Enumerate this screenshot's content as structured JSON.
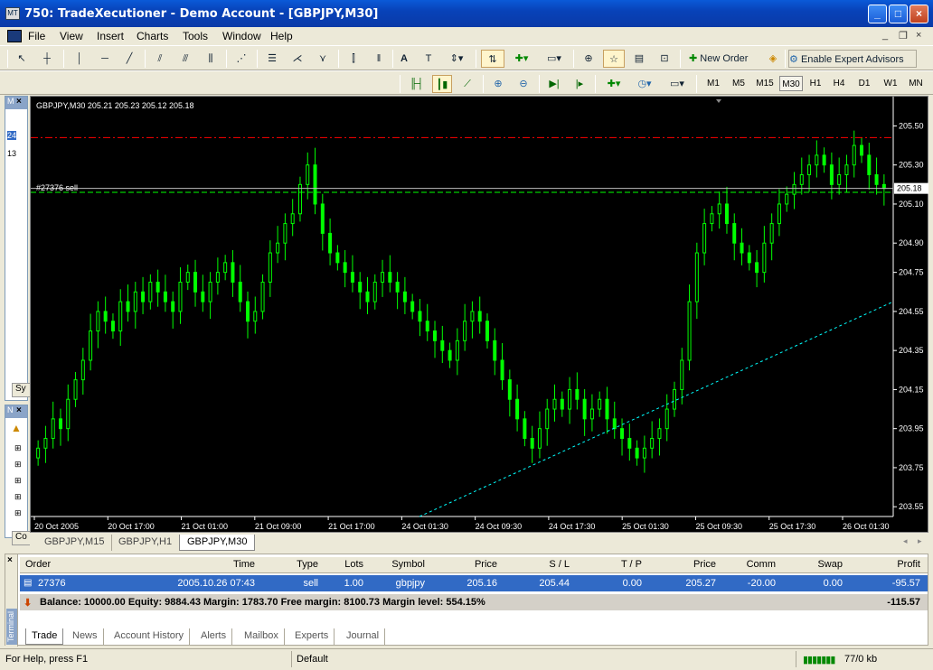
{
  "window": {
    "title": "750: TradeXecutioner - Demo Account - [GBPJPY,M30]",
    "app_icon": "mt-icon",
    "controls": [
      "minimize",
      "maximize",
      "close"
    ]
  },
  "menu": {
    "items": [
      "File",
      "View",
      "Insert",
      "Charts",
      "Tools",
      "Window",
      "Help"
    ],
    "mdi_controls": [
      "_",
      "❐",
      "×"
    ]
  },
  "toolbar": {
    "text_tool": "A",
    "new_order_label": "New Order",
    "expert_label": "Enable Expert Advisors"
  },
  "timeframes": [
    "M1",
    "M5",
    "M15",
    "M30",
    "H1",
    "H4",
    "D1",
    "W1",
    "MN"
  ],
  "active_timeframe": "M30",
  "chart": {
    "header": "GBPJPY,M30  205.21 205.23 205.12 205.18",
    "order_label": "#27376 sell",
    "current_price": "205.18",
    "price_ticks": [
      "205.50",
      "205.30",
      "205.10",
      "204.90",
      "204.75",
      "204.55",
      "204.35",
      "204.15",
      "203.95",
      "203.75",
      "203.55"
    ],
    "time_ticks": [
      "20 Oct 2005",
      "20 Oct 17:00",
      "21 Oct 01:00",
      "21 Oct 09:00",
      "21 Oct 17:00",
      "24 Oct 01:30",
      "24 Oct 09:30",
      "24 Oct 17:30",
      "25 Oct 01:30",
      "25 Oct 09:30",
      "25 Oct 17:30",
      "26 Oct 01:30"
    ],
    "colors": {
      "background": "#000000",
      "candles": "#00ff00",
      "stop_loss": "#ff0000",
      "trend_line": "#00ffff",
      "grid_text": "#ffffff"
    }
  },
  "chart_data": {
    "type": "candlestick",
    "title": "GBPJPY,M30",
    "ylim": [
      203.5,
      205.65
    ],
    "closes": [
      203.85,
      203.9,
      204.0,
      203.95,
      204.1,
      204.2,
      204.3,
      204.45,
      204.55,
      204.5,
      204.45,
      204.6,
      204.55,
      204.65,
      204.6,
      204.7,
      204.65,
      204.6,
      204.55,
      204.7,
      204.75,
      204.65,
      204.6,
      204.7,
      204.75,
      204.8,
      204.7,
      204.6,
      204.5,
      204.55,
      204.7,
      204.85,
      204.9,
      205.0,
      205.05,
      205.2,
      205.3,
      205.1,
      204.95,
      204.85,
      204.8,
      204.75,
      204.7,
      204.65,
      204.6,
      204.7,
      204.75,
      204.7,
      204.65,
      204.6,
      204.55,
      204.5,
      204.45,
      204.4,
      204.35,
      204.3,
      204.4,
      204.5,
      204.55,
      204.5,
      204.4,
      204.3,
      204.2,
      204.1,
      204.0,
      203.9,
      203.85,
      203.95,
      204.05,
      204.1,
      204.05,
      204.15,
      204.1,
      204.0,
      204.05,
      204.1,
      204.0,
      203.95,
      203.9,
      203.85,
      203.8,
      203.85,
      203.9,
      203.95,
      204.05,
      204.15,
      204.3,
      204.6,
      204.85,
      205.0,
      205.05,
      205.1,
      205.0,
      204.9,
      204.85,
      204.8,
      204.75,
      204.9,
      205.0,
      205.1,
      205.15,
      205.2,
      205.25,
      205.3,
      205.35,
      205.3,
      205.2,
      205.25,
      205.3,
      205.4,
      205.35,
      205.25,
      205.2,
      205.18
    ],
    "stop_loss": 205.44,
    "order_price": 205.16,
    "current_price": 205.18
  },
  "chart_tabs": [
    "GBPJPY,M15",
    "GBPJPY,H1",
    "GBPJPY,M30"
  ],
  "active_chart_tab": "GBPJPY,M30",
  "left_panel": {
    "tab1": "Sy",
    "tab2": "Co",
    "label_m": "M",
    "label_n": "N",
    "item1": "24",
    "item2": "13"
  },
  "terminal": {
    "side_label": "Terminal",
    "columns": [
      "Order",
      "Time",
      "Type",
      "Lots",
      "Symbol",
      "Price",
      "S / L",
      "T / P",
      "Price",
      "Comm",
      "Swap",
      "Profit"
    ],
    "row": [
      "27376",
      "2005.10.26 07:43",
      "sell",
      "1.00",
      "gbpjpy",
      "205.16",
      "205.44",
      "0.00",
      "205.27",
      "-20.00",
      "0.00",
      "-95.57"
    ],
    "balance_text": "Balance: 10000.00  Equity: 9884.43  Margin: 1783.70  Free margin: 8100.73  Margin level: 554.15%",
    "balance_total": "-115.57",
    "tabs": [
      "Trade",
      "News",
      "Account History",
      "Alerts",
      "Mailbox",
      "Experts",
      "Journal"
    ],
    "active_tab": "Trade"
  },
  "status": {
    "help": "For Help, press F1",
    "profile": "Default",
    "traffic": "77/0 kb"
  }
}
